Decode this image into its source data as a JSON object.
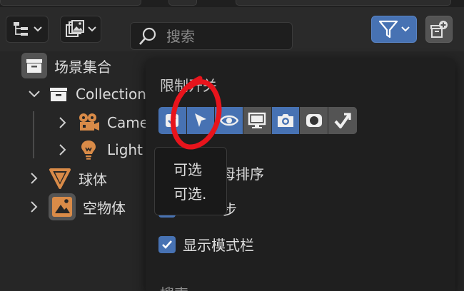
{
  "header": {
    "search_placeholder": "搜索"
  },
  "icons": {
    "display_mode": "outliner-display-icon",
    "image_filter": "image-filter-icon",
    "filter": "funnel-icon",
    "new_collection": "new-collection-icon"
  },
  "tree": {
    "scene_collection": "场景集合",
    "collection": "Collection",
    "camera": "Camera",
    "light": "Light",
    "sphere": "球体",
    "empty": "空物体"
  },
  "filter_panel": {
    "restriction_title": "限制开关",
    "toggles": [
      {
        "name": "exclude-checkbox",
        "state": "on"
      },
      {
        "name": "selectable",
        "state": "on"
      },
      {
        "name": "hide-in-viewport",
        "state": "on"
      },
      {
        "name": "disable-in-viewports",
        "state": "off"
      },
      {
        "name": "disable-in-renders",
        "state": "on"
      },
      {
        "name": "holdout",
        "state": "off"
      },
      {
        "name": "indirect-only",
        "state": "off"
      }
    ],
    "sort_alpha_visible": "母排序",
    "sync_visible": "步",
    "show_mode_column": "显示模式栏",
    "search_section": "搜索"
  },
  "tooltip": {
    "title": "可选",
    "description": "可选."
  },
  "colors": {
    "accent": "#4772b3",
    "annotation": "#e8141c",
    "camera_orange": "#d98b48"
  }
}
